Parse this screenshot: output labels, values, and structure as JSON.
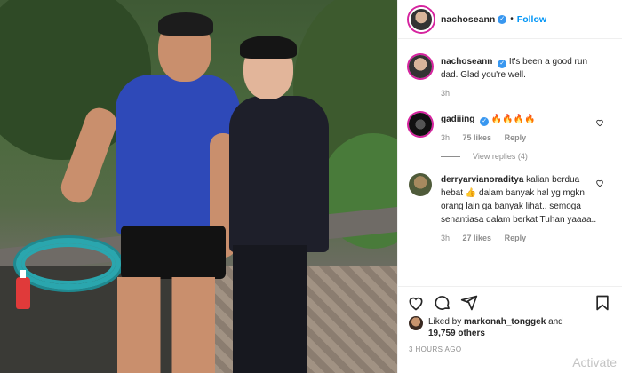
{
  "post": {
    "author": "nachoseann",
    "follow_label": "Follow",
    "separator": "•"
  },
  "comments": [
    {
      "user": "nachoseann",
      "text": "It's been a good run dad. Glad you're well.",
      "time": "3h",
      "likes": "",
      "reply": ""
    },
    {
      "user": "gadiiing",
      "text": "🔥🔥🔥🔥",
      "time": "3h",
      "likes": "75 likes",
      "reply": "Reply",
      "view_replies": "View replies (4)"
    },
    {
      "user": "derryarvianoraditya",
      "text": "kalian berdua hebat 👍 dalam banyak hal yg mgkn orang lain ga banyak lihat.. semoga senantiasa dalam berkat Tuhan yaaaa..",
      "time": "3h",
      "likes": "27 likes",
      "reply": "Reply"
    }
  ],
  "likes_line": {
    "prefix": "Liked by",
    "user": "markonah_tonggek",
    "connector": "and",
    "count": "19,759 others"
  },
  "timestamp": "3 HOURS AGO",
  "watermark": "Activate",
  "icons": {
    "like": "heart-icon",
    "comment": "comment-icon",
    "share": "paper-plane-icon",
    "save": "bookmark-icon",
    "verified": "verified-badge-icon"
  },
  "colors": {
    "accent": "#0095f6",
    "verified": "#3897f0",
    "muted": "#8e8e8e",
    "text": "#262626"
  }
}
